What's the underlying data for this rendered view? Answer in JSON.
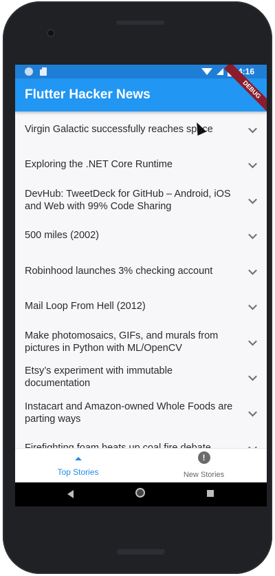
{
  "status_bar": {
    "time": "4:16",
    "icons": [
      "circle-icon",
      "sd-card-icon",
      "wifi-icon",
      "signal-icon",
      "battery-icon"
    ]
  },
  "app_bar": {
    "title": "Flutter Hacker News",
    "debug_banner": "DEBUG",
    "color": "#2196f3"
  },
  "stories": [
    {
      "title": "Virgin Galactic successfully reaches space"
    },
    {
      "title": "Exploring the .NET Core Runtime"
    },
    {
      "title": "DevHub: TweetDeck for GitHub – Android, iOS and Web with 99% Code Sharing"
    },
    {
      "title": "500 miles (2002)"
    },
    {
      "title": "Robinhood launches 3% checking account"
    },
    {
      "title": "Mail Loop From Hell (2012)"
    },
    {
      "title": "Make photomosaics, GIFs, and murals from pictures in Python with ML/OpenCV"
    },
    {
      "title": "Etsy’s experiment with immutable documentation"
    },
    {
      "title": "Instacart and Amazon-owned Whole Foods are parting ways"
    },
    {
      "title": "Firefighting foam heats up coal fire debate"
    }
  ],
  "bottom_nav": {
    "items": [
      {
        "label": "Top Stories",
        "icon": "triangle-icon",
        "active": true
      },
      {
        "label": "New Stories",
        "icon": "new-badge-icon",
        "active": false
      }
    ],
    "new_badge_symbol": "!"
  },
  "system_nav": {
    "icons": [
      "back-icon",
      "home-icon",
      "recents-icon"
    ]
  }
}
